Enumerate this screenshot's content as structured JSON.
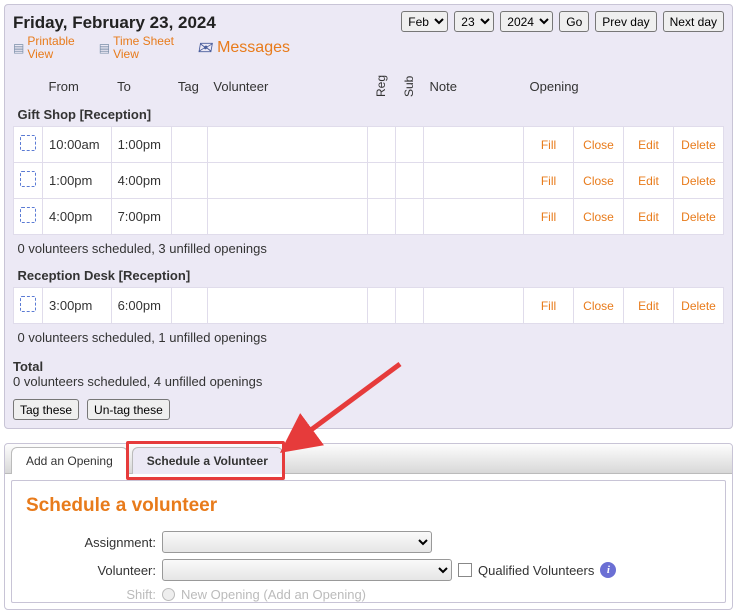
{
  "header": {
    "date_title": "Friday, February 23, 2024",
    "month_value": "Feb",
    "day_value": "23",
    "year_value": "2024",
    "go_label": "Go",
    "prev_label": "Prev day",
    "next_label": "Next day"
  },
  "views": {
    "printable_l1": "Printable",
    "printable_l2": "View",
    "timesheet_l1": "Time Sheet",
    "timesheet_l2": "View",
    "messages": "Messages"
  },
  "columns": {
    "from": "From",
    "to": "To",
    "tag": "Tag",
    "volunteer": "Volunteer",
    "reg": "Reg",
    "sub": "Sub",
    "note": "Note",
    "opening": "Opening"
  },
  "groups": [
    {
      "title": "Gift Shop [Reception]",
      "rows": [
        {
          "from": "10:00am",
          "to": "1:00pm"
        },
        {
          "from": "1:00pm",
          "to": "4:00pm"
        },
        {
          "from": "4:00pm",
          "to": "7:00pm"
        }
      ],
      "summary": "0 volunteers scheduled, 3 unfilled openings"
    },
    {
      "title": "Reception Desk [Reception]",
      "rows": [
        {
          "from": "3:00pm",
          "to": "6:00pm"
        }
      ],
      "summary": "0 volunteers scheduled, 1 unfilled openings"
    }
  ],
  "actions": {
    "fill": "Fill",
    "close": "Close",
    "edit": "Edit",
    "delete": "Delete"
  },
  "totals": {
    "label": "Total",
    "line": "0 volunteers scheduled, 4 unfilled openings"
  },
  "tag_buttons": {
    "tag": "Tag these",
    "untag": "Un-tag these"
  },
  "tabs": {
    "add_opening": "Add an Opening",
    "schedule_vol": "Schedule a Volunteer"
  },
  "form": {
    "heading": "Schedule a volunteer",
    "assignment_label": "Assignment:",
    "volunteer_label": "Volunteer:",
    "qualified_label": "Qualified Volunteers",
    "shift_label": "Shift:",
    "new_opening_text": "New Opening (Add an Opening)"
  }
}
